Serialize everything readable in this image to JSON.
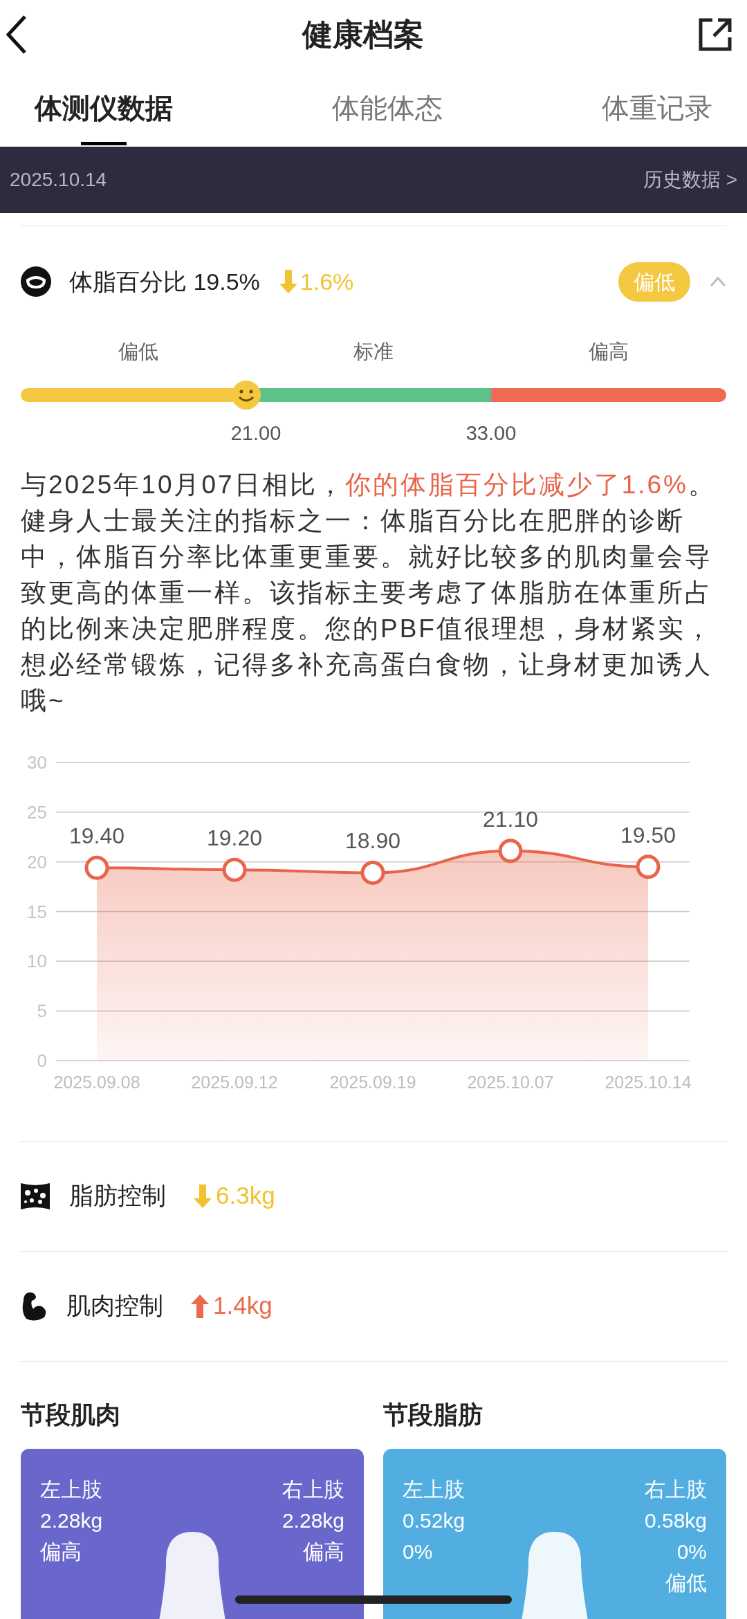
{
  "header": {
    "title": "健康档案"
  },
  "tabs": [
    {
      "label": "体测仪数据",
      "selected": true
    },
    {
      "label": "体能体态",
      "selected": false
    },
    {
      "label": "体重记录",
      "selected": false
    }
  ],
  "date_bar": {
    "date": "2025.10.14",
    "history_link": "历史数据 >"
  },
  "metric": {
    "name": "体脂百分比 19.5%",
    "change": "1.6%",
    "kind": "down",
    "badge": "偏低",
    "expanded": true
  },
  "range": {
    "segments": [
      {
        "label": "偏低",
        "color": "#f5c842"
      },
      {
        "label": "标准",
        "color": "#5ec38a"
      },
      {
        "label": "偏高",
        "color": "#ee6a50"
      }
    ],
    "ticks": [
      "21.00",
      "33.00"
    ]
  },
  "comparison": {
    "prefix": "与2025年10月07日相比，",
    "highlight": "你的体脂百分比减少了1.6%",
    "suffix": "。"
  },
  "description": "健身人士最关注的指标之一：体脂百分比在肥胖的诊断中，体脂百分率比体重更重要。就好比较多的肌肉量会导致更高的体重一样。该指标主要考虑了体脂肪在体重所占的比例来决定肥胖程度。您的PBF值很理想，身材紧实，想必经常锻炼，记得多补充高蛋白食物，让身材更加诱人哦~",
  "chart_data": {
    "type": "area",
    "categories": [
      "2025.09.08",
      "2025.09.12",
      "2025.09.19",
      "2025.10.07",
      "2025.10.14"
    ],
    "series": [
      {
        "color": "#e8644a",
        "values": [
          19.4,
          19.2,
          18.9,
          21.1,
          19.5
        ]
      }
    ],
    "ylim": [
      0,
      30
    ],
    "grid": true,
    "yticks": [
      0,
      5,
      10,
      15,
      20,
      25,
      30
    ],
    "value_labels": [
      "19.40",
      "19.20",
      "18.90",
      "21.10",
      "19.50"
    ]
  },
  "controls": [
    {
      "kind": "down",
      "label": "脂肪控制",
      "change": "6.3kg"
    },
    {
      "kind": "up",
      "label": "肌肉控制",
      "change": "1.4kg"
    }
  ],
  "segments": [
    {
      "title": "节段肌肉",
      "kind": "muscle",
      "left": {
        "label": "左上肢",
        "lines": [
          "2.28kg",
          "偏高"
        ]
      },
      "right": {
        "label": "右上肢",
        "lines": [
          "2.28kg",
          "偏高"
        ]
      }
    },
    {
      "title": "节段脂肪",
      "kind": "fat",
      "left": {
        "label": "左上肢",
        "lines": [
          "0.52kg",
          "0%"
        ]
      },
      "right": {
        "label": "右上肢",
        "lines": [
          "0.58kg",
          "0%",
          "偏低"
        ]
      }
    }
  ]
}
